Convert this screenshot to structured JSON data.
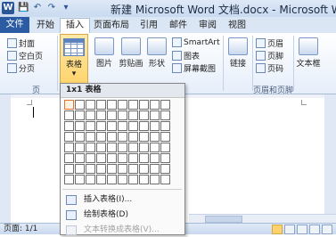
{
  "app": {
    "icon_letter": "W",
    "title": "新建 Microsoft Word 文档.docx - Microsoft Wor",
    "qat": [
      "💾",
      "↶",
      "↷",
      "▾"
    ]
  },
  "tabs": [
    "文件",
    "开始",
    "插入",
    "页面布局",
    "引用",
    "邮件",
    "审阅",
    "视图"
  ],
  "active_tab": "插入",
  "ribbon": {
    "pages_group": {
      "cover": "封面",
      "blank": "空白页",
      "break": "分页",
      "label": "页"
    },
    "table_button": "表格",
    "table_arrow": "▾",
    "picture": "图片",
    "clipart": "剪贴画",
    "shapes": "形状",
    "smartart": "SmartArt",
    "chart": "图表",
    "screenshot": "屏幕截图",
    "link": "链接",
    "header": "页眉",
    "footer": "页脚",
    "page_number": "页码",
    "header_footer_label": "页眉和页脚",
    "textbox": "文本框"
  },
  "table_menu": {
    "header": "1x1 表格",
    "grid_rows": 8,
    "grid_cols": 10,
    "selected": [
      1,
      1
    ],
    "items": [
      {
        "label": "插入表格(I)...",
        "disabled": false
      },
      {
        "label": "绘制表格(D)",
        "disabled": false
      },
      {
        "label": "文本转换成表格(V)...",
        "disabled": true
      }
    ]
  },
  "status": {
    "pages": "页面: 1/1"
  }
}
